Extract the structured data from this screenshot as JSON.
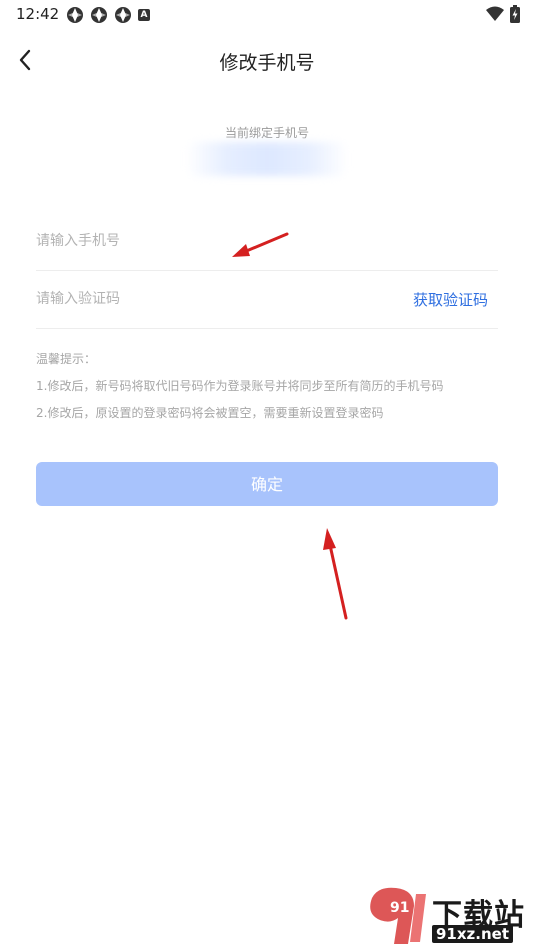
{
  "status_bar": {
    "time": "12:42",
    "left_icons": [
      "app-icon",
      "app-icon",
      "app-icon",
      "a-badge-icon"
    ],
    "a_badge": "A",
    "right_icons": [
      "wifi-icon",
      "battery-charging-icon"
    ]
  },
  "header": {
    "title": "修改手机号",
    "back_icon": "chevron-left-icon"
  },
  "bound_phone": {
    "label": "当前绑定手机号"
  },
  "form": {
    "phone_placeholder": "请输入手机号",
    "code_placeholder": "请输入验证码",
    "get_code_label": "获取验证码"
  },
  "tips": {
    "title": "温馨提示：",
    "line1": "1.修改后，新号码将取代旧号码作为登录账号并将同步至所有简历的手机号码",
    "line2": "2.修改后，原设置的登录密码将会被置空，需要重新设置登录密码"
  },
  "confirm_label": "确定",
  "watermark": {
    "logo_text": "91",
    "cn": "下载站",
    "url": "91xz.net"
  },
  "colors": {
    "accent": "#2f6fe0",
    "button_disabled": "#a8c3fc",
    "annotation_arrow": "#d42020"
  }
}
